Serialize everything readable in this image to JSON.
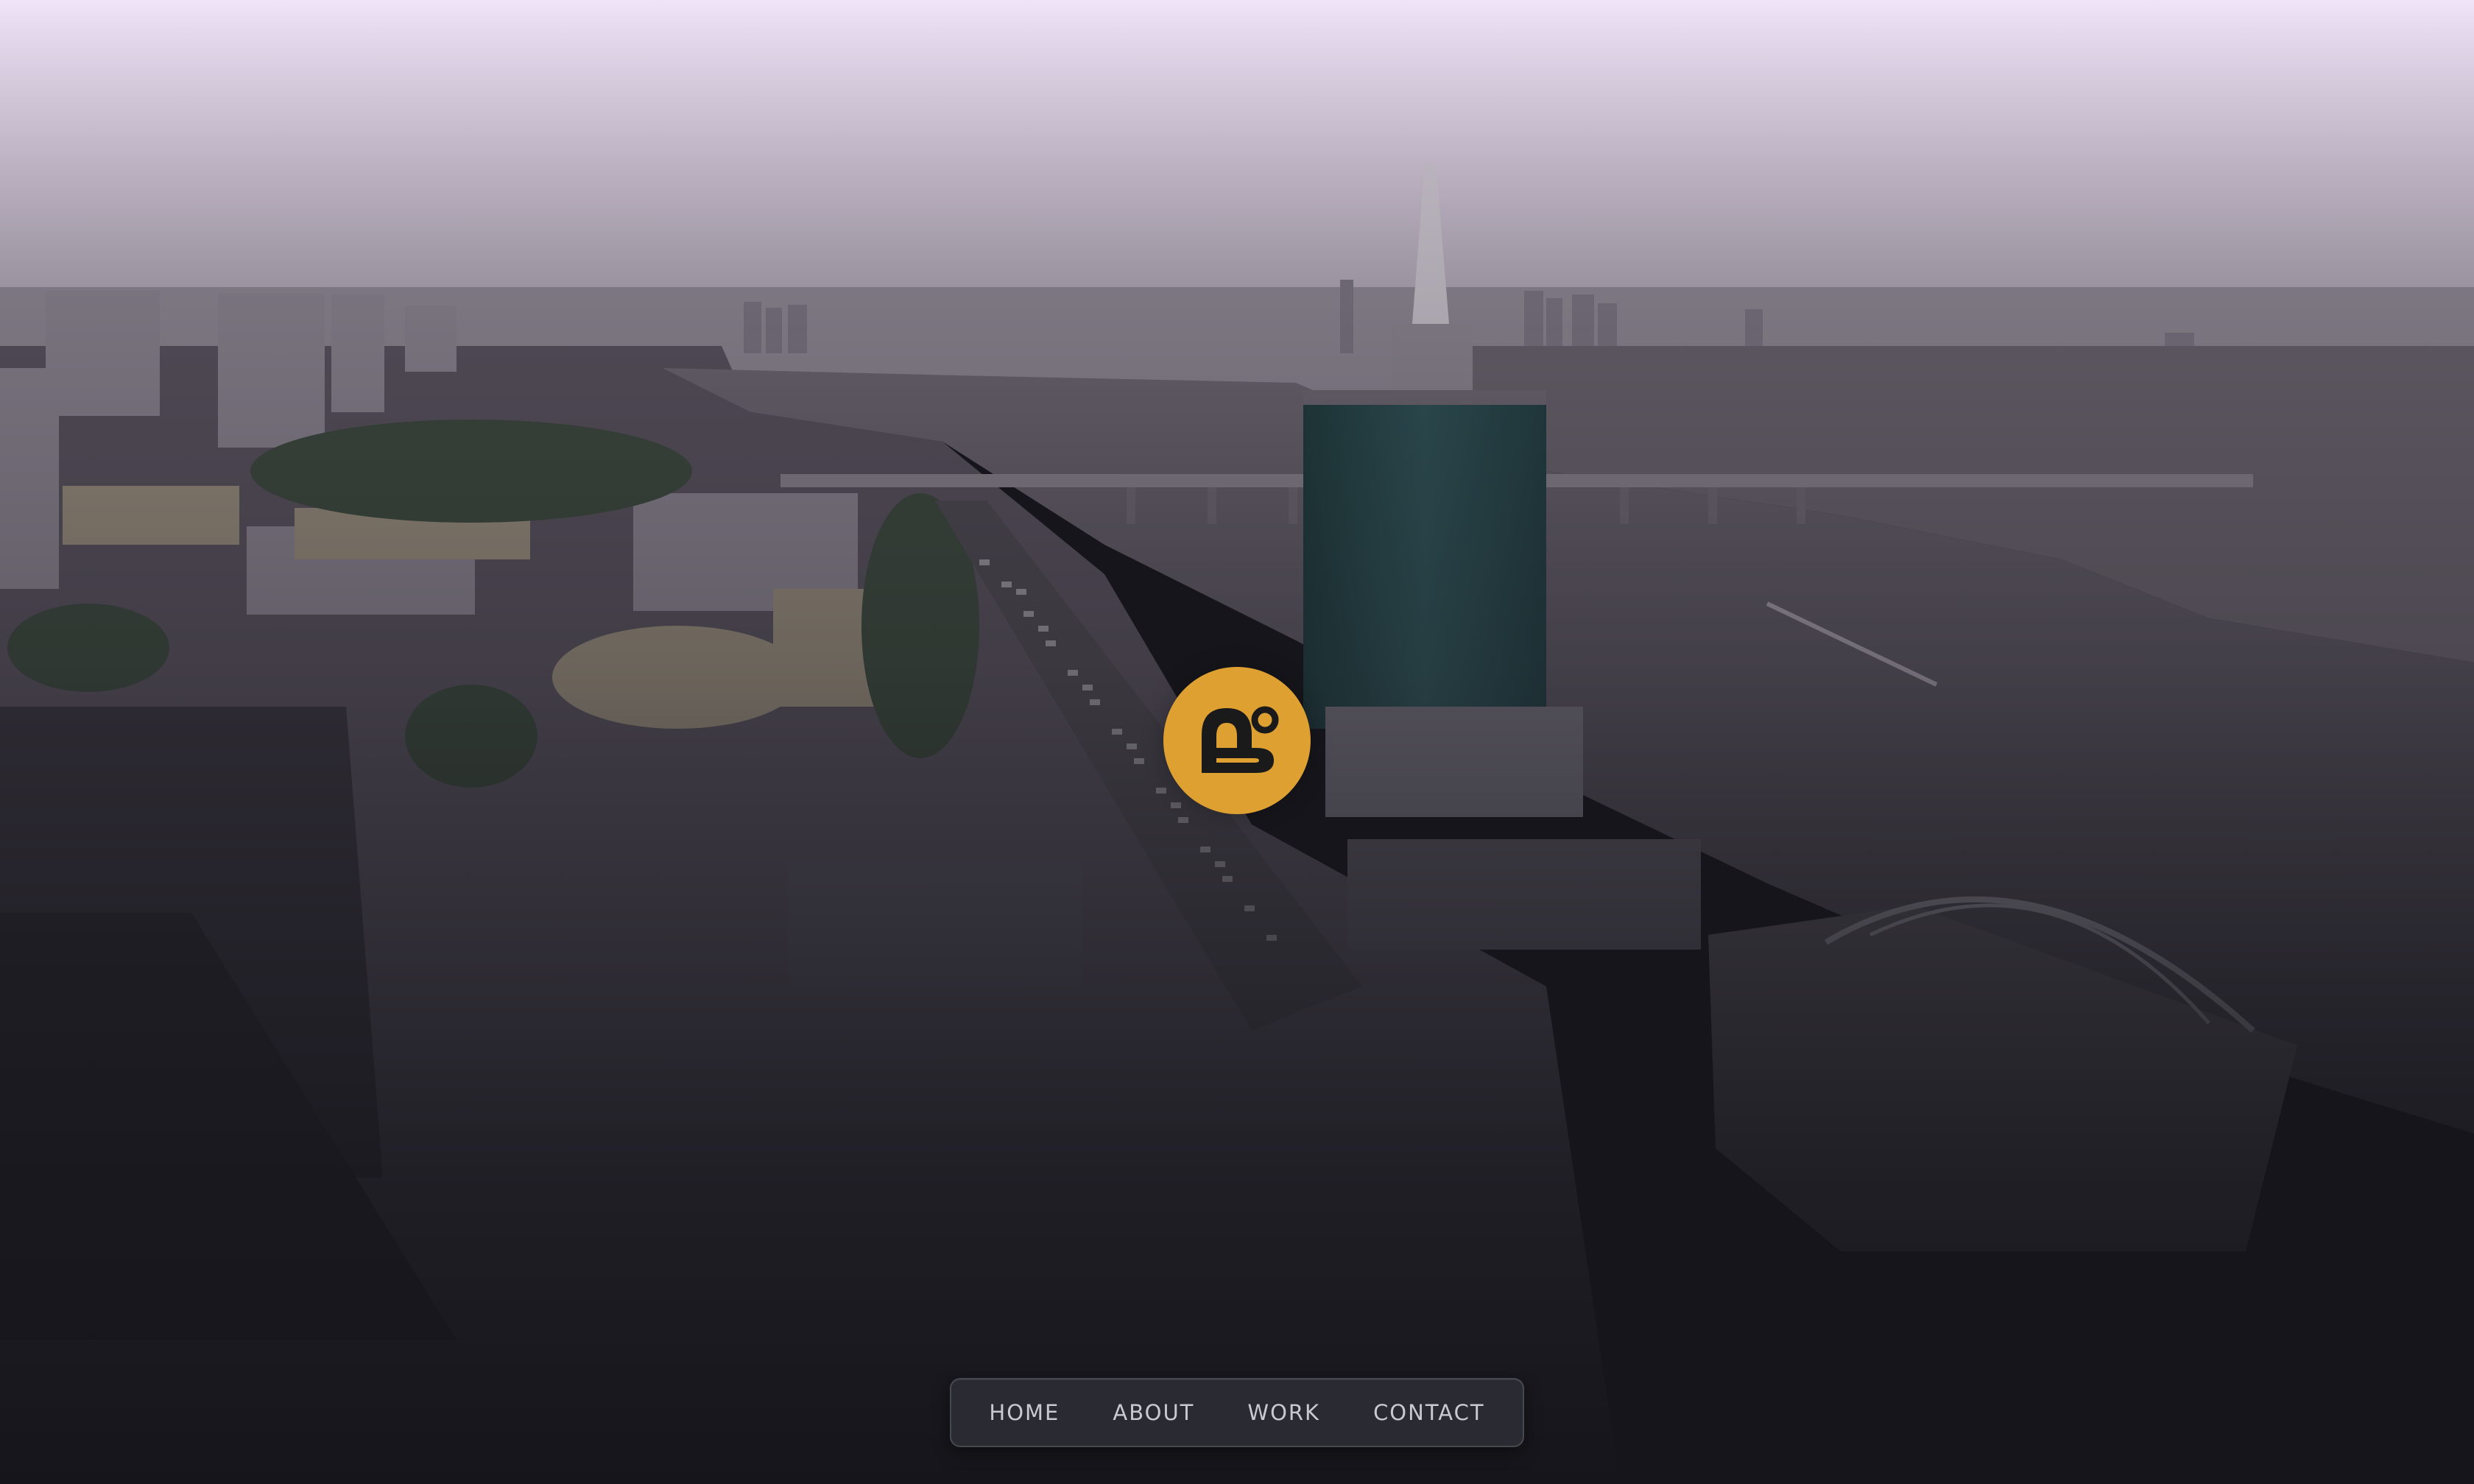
{
  "hero": {
    "background_icon": "city-aerial-photo",
    "tint_top": "#efe4f8",
    "tint_bottom": "#15151b"
  },
  "logo": {
    "icon": "ab-monogram-icon",
    "background_color": "#dea131",
    "glyph_color": "#1a1a1a"
  },
  "nav": {
    "items": [
      {
        "label": "HOME"
      },
      {
        "label": "ABOUT"
      },
      {
        "label": "WORK"
      },
      {
        "label": "CONTACT"
      }
    ]
  }
}
